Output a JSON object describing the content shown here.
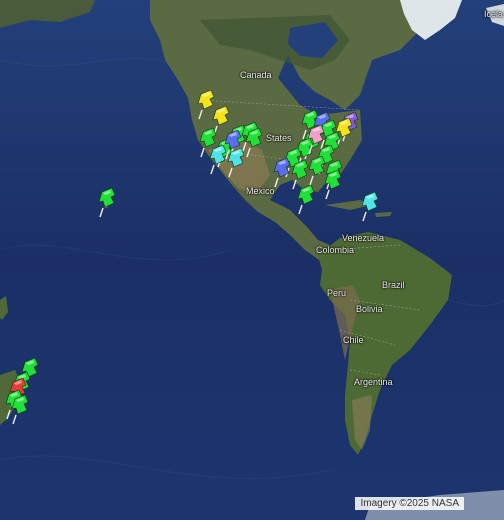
{
  "labels": {
    "canada": "Canada",
    "states": "States",
    "mexico": "Mexico",
    "venezuela": "Venezuela",
    "colombia": "Colombia",
    "brazil": "Brazil",
    "peru": "Peru",
    "bolivia": "Bolivia",
    "chile": "Chile",
    "argentina": "Argentina",
    "iceland": "Icela"
  },
  "attribution": "Imagery ©2025 NASA",
  "colors": {
    "green": "#22e03a",
    "yellow": "#f4e21a",
    "cyan": "#4fe3e6",
    "blue": "#5a6df0",
    "purple": "#8a55e8",
    "pink": "#f2a0c8",
    "red": "#e83a3a"
  },
  "pins": [
    {
      "color": "yellow"
    },
    {
      "color": "yellow"
    },
    {
      "color": "green"
    },
    {
      "color": "green"
    },
    {
      "color": "cyan"
    },
    {
      "color": "green"
    },
    {
      "color": "green"
    },
    {
      "color": "blue"
    },
    {
      "color": "cyan"
    },
    {
      "color": "green"
    },
    {
      "color": "green"
    },
    {
      "color": "blue"
    },
    {
      "color": "purple"
    },
    {
      "color": "green"
    },
    {
      "color": "yellow"
    },
    {
      "color": "green"
    },
    {
      "color": "green"
    },
    {
      "color": "green"
    },
    {
      "color": "pink"
    },
    {
      "color": "green"
    },
    {
      "color": "green"
    },
    {
      "color": "blue"
    },
    {
      "color": "green"
    },
    {
      "color": "green"
    },
    {
      "color": "green"
    },
    {
      "color": "green"
    },
    {
      "color": "green"
    },
    {
      "color": "green"
    },
    {
      "color": "cyan"
    },
    {
      "color": "green"
    },
    {
      "color": "green"
    },
    {
      "color": "red"
    },
    {
      "color": "green"
    },
    {
      "color": "green"
    }
  ]
}
